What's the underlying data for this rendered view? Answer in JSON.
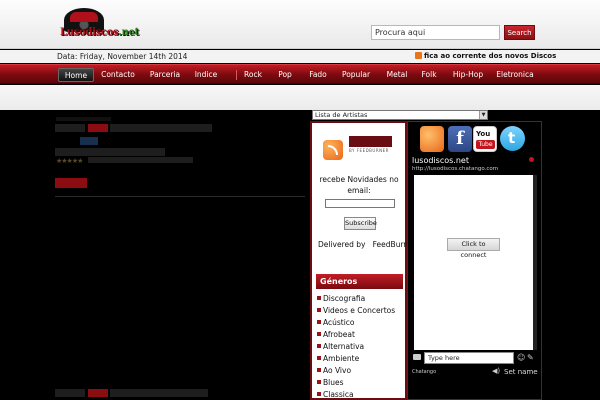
{
  "header": {
    "logo_text_main": "Lusodiscos",
    "logo_text_tld": ".net",
    "search_placeholder": "Procura aqui",
    "search_button": "Search"
  },
  "datebar": {
    "date": "Data: Friday, November 14th 2014",
    "news": "fica ao corrente dos novos Discos"
  },
  "nav": {
    "items": [
      "Home",
      "Contacto",
      "Parceria",
      "Indice",
      "Rock",
      "Pop",
      "Fado",
      "Popular",
      "Metal",
      "Folk",
      "Hip-Hop",
      "Eletronica"
    ]
  },
  "sidebar": {
    "select_label": "Lista de Artistas",
    "feedburner_sub": "BY FEEDBURNER",
    "subscribe_text": "recebe Novidades no email:",
    "subscribe_button": "Subscribe",
    "delivered_by": "Delivered by",
    "feedburner": "FeedBurner",
    "genres_title": "Géneros",
    "genres": [
      "Discografia",
      "Videos e Concertos",
      "Acústico",
      "Afrobeat",
      "Alternativa",
      "Ambiente",
      "Ao Vivo",
      "Blues",
      "Classica"
    ]
  },
  "chat": {
    "title": "lusodiscos.net",
    "url": "http://lusodiscos.chatango.com",
    "connect": "Click to connect",
    "type_placeholder": "Type here",
    "brand": "Chatango",
    "set_name": "Set name",
    "youtube_you": "You",
    "youtube_tube": "Tube",
    "facebook_glyph": "f"
  },
  "colors": {
    "accent": "#9b1118",
    "nav_top": "#c01c24",
    "nav_bottom": "#5a070b"
  }
}
